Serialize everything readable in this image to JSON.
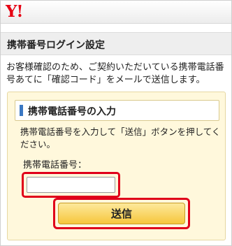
{
  "header": {
    "logo_text": "Y!",
    "brand_color": "#e60012"
  },
  "section": {
    "title": "携帯番号ログイン設定",
    "intro": "お客様確認のため、ご契約いただいている携帯電話番号あてに「確認コード」をメールで送信します。"
  },
  "panel": {
    "title": "携帯電話番号の入力",
    "description": "携帯電話番号を入力して「送信」ボタンを押してください。",
    "field_label": "携帯電話番号：",
    "phone_value": "",
    "submit_label": "送信",
    "highlight_color": "#e0001a",
    "accent_color": "#3b78c3"
  }
}
